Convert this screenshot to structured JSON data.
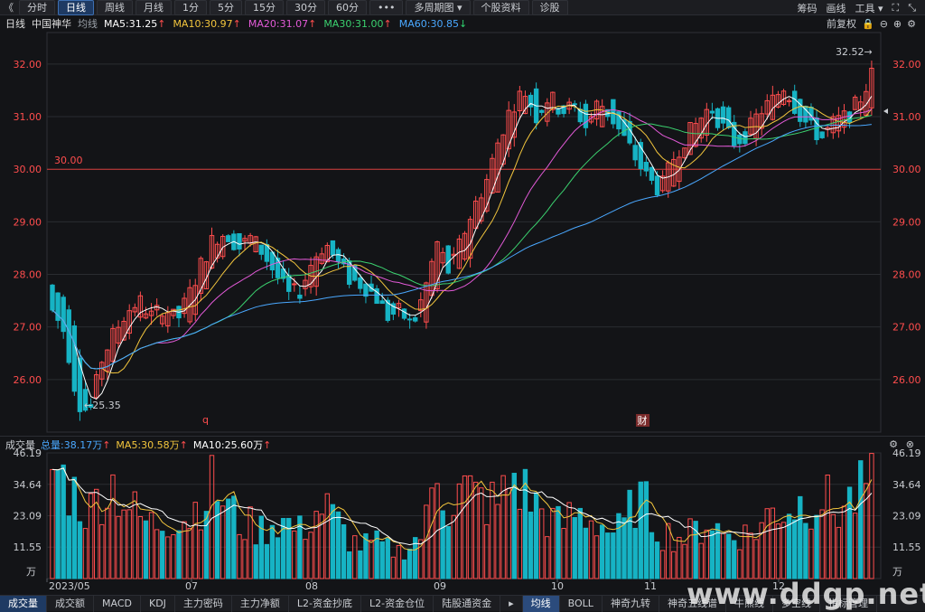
{
  "toolbar": {
    "back_icon": "double-chevron-left-icon",
    "tabs": [
      "分时",
      "日线",
      "周线",
      "月线",
      "1分",
      "5分",
      "15分",
      "30分",
      "60分",
      "•••",
      "多周期图",
      "个股资料",
      "诊股"
    ],
    "active_tab": "日线",
    "right": [
      "筹码",
      "画线",
      "工具"
    ],
    "icons": [
      "fullscreen-icon",
      "exit-fullscreen-icon"
    ]
  },
  "legend": {
    "period": "日线",
    "stock": "中国神华",
    "label": "均线",
    "ma": [
      {
        "text": "MA5:31.25",
        "arrow": "↑",
        "color": "#ffffff"
      },
      {
        "text": "MA10:30.97",
        "arrow": "↑",
        "color": "#f2c53d"
      },
      {
        "text": "MA20:31.07",
        "arrow": "↑",
        "color": "#e35ad8"
      },
      {
        "text": "MA30:31.00",
        "arrow": "↑",
        "color": "#3bd16f"
      },
      {
        "text": "MA60:30.85",
        "arrow": "↓",
        "color": "#4aa8ff"
      }
    ],
    "adjust": "前复权"
  },
  "volume_header": {
    "title": "成交量",
    "total": "总量:38.17万",
    "total_arrow": "↑",
    "ma5": "MA5:30.58万",
    "ma5_arrow": "↑",
    "ma10": "MA10:25.60万",
    "ma10_arrow": "↑"
  },
  "bottom_tabs": [
    "成交量",
    "成交额",
    "MACD",
    "KDJ",
    "主力密码",
    "主力净额",
    "L2-资金抄底",
    "L2-资金仓位",
    "陆股通资金",
    "均线",
    "BOLL",
    "神奇九转",
    "神奇五线谱",
    "牛熊线",
    "多空线",
    "指标管理"
  ],
  "active_bottom": [
    "成交量",
    "均线"
  ],
  "watermark": "www.ddgp.net",
  "chart_data": {
    "type": "candlestick",
    "price_axis": {
      "ticks": [
        "32.00",
        "31.00",
        "30.00",
        "29.00",
        "28.00",
        "27.00",
        "26.00"
      ],
      "ylim": [
        25.0,
        32.6
      ]
    },
    "volume_axis": {
      "ticks": [
        "46.19",
        "34.64",
        "23.09",
        "11.55"
      ],
      "unit": "万",
      "ylim": [
        0,
        46.19
      ]
    },
    "x_labels": [
      "2023/05",
      "07",
      "08",
      "09",
      "10",
      "11",
      "12"
    ],
    "annotations": {
      "high": "32.52",
      "low": "25.35",
      "ref_line": "30.00",
      "markers": [
        "q",
        "财"
      ]
    },
    "price_samples": [
      [
        27.8,
        27.3
      ],
      [
        27.5,
        26.9
      ],
      [
        26.8,
        25.6
      ],
      [
        25.5,
        25.35
      ],
      [
        26.0,
        26.4
      ],
      [
        26.5,
        26.9
      ],
      [
        27.0,
        27.3
      ],
      [
        27.2,
        27.5
      ],
      [
        27.3,
        27.2
      ],
      [
        27.0,
        27.4
      ],
      [
        27.4,
        27.1
      ],
      [
        27.2,
        27.6
      ],
      [
        27.6,
        28.2
      ],
      [
        28.2,
        28.7
      ],
      [
        28.6,
        28.8
      ],
      [
        28.8,
        28.5
      ],
      [
        28.5,
        28.7
      ],
      [
        28.7,
        28.4
      ],
      [
        28.3,
        28.0
      ],
      [
        28.0,
        27.6
      ],
      [
        27.6,
        27.7
      ],
      [
        27.8,
        28.3
      ],
      [
        28.3,
        28.6
      ],
      [
        28.6,
        28.2
      ],
      [
        28.1,
        27.9
      ],
      [
        27.9,
        27.8
      ],
      [
        27.8,
        27.6
      ],
      [
        27.5,
        27.2
      ],
      [
        27.2,
        27.3
      ],
      [
        27.3,
        27.0
      ],
      [
        27.1,
        27.7
      ],
      [
        27.7,
        28.6
      ],
      [
        28.6,
        28.0
      ],
      [
        28.0,
        28.7
      ],
      [
        28.7,
        29.3
      ],
      [
        29.3,
        29.8
      ],
      [
        29.8,
        30.6
      ],
      [
        30.6,
        31.2
      ],
      [
        31.2,
        31.5
      ],
      [
        31.5,
        31.0
      ],
      [
        31.0,
        31.4
      ],
      [
        31.4,
        31.1
      ],
      [
        31.1,
        31.2
      ],
      [
        31.2,
        30.8
      ],
      [
        30.8,
        31.3
      ],
      [
        31.3,
        31.0
      ],
      [
        31.0,
        30.6
      ],
      [
        30.5,
        30.2
      ],
      [
        30.2,
        29.8
      ],
      [
        29.8,
        29.6
      ],
      [
        29.6,
        30.2
      ],
      [
        30.2,
        30.6
      ],
      [
        30.6,
        30.9
      ],
      [
        30.9,
        31.2
      ],
      [
        31.2,
        30.8
      ],
      [
        30.8,
        30.5
      ],
      [
        30.5,
        30.7
      ],
      [
        30.7,
        31.1
      ],
      [
        31.1,
        31.3
      ],
      [
        31.3,
        31.6
      ],
      [
        31.6,
        31.1
      ],
      [
        31.1,
        30.8
      ],
      [
        30.8,
        30.6
      ],
      [
        30.6,
        30.9
      ],
      [
        30.9,
        31.0
      ],
      [
        31.0,
        31.3
      ],
      [
        31.3,
        31.8
      ]
    ],
    "volume_samples": [
      41,
      36,
      30,
      24,
      33,
      35,
      28,
      22,
      20,
      21,
      24,
      22,
      30,
      34,
      27,
      21,
      19,
      18,
      22,
      20,
      17,
      24,
      26,
      20,
      14,
      12,
      13,
      11,
      10,
      13,
      18,
      42,
      25,
      33,
      30,
      28,
      27,
      38,
      32,
      27,
      22,
      19,
      24,
      23,
      21,
      17,
      18,
      30,
      25,
      17,
      16,
      15,
      18,
      22,
      16,
      17,
      16,
      19,
      25,
      26,
      27,
      29,
      31,
      24,
      28,
      30,
      40
    ]
  }
}
